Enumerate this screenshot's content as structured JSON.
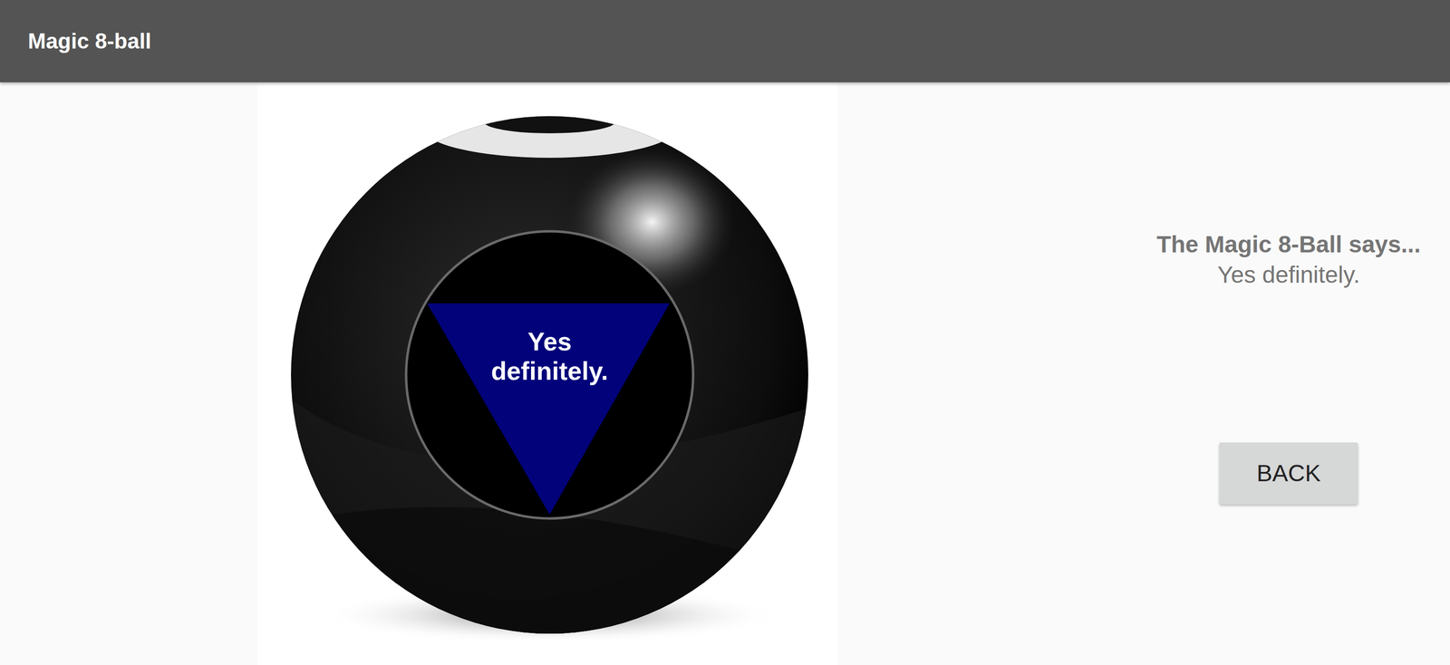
{
  "window": {
    "title": "Magic 8-ball"
  },
  "ball": {
    "text": "Yes definitely."
  },
  "result": {
    "heading": "The Magic 8-Ball says...",
    "answer": "Yes definitely."
  },
  "buttons": [
    "BACK"
  ]
}
